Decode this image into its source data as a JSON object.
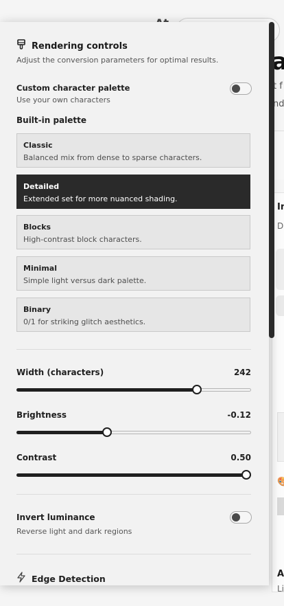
{
  "background": {
    "at_text": "At",
    "heading_fragment": "a",
    "line1_fragment": "t f",
    "line2_fragment": "nd",
    "card_title_fragment": "In",
    "card_sub_fragment": "Dr",
    "bottom_title_fragment": "A",
    "bottom_sub_fragment": "Li"
  },
  "panel": {
    "title": "Rendering controls",
    "title_icon": "brush-icon",
    "subtitle": "Adjust the conversion parameters for optimal results.",
    "custom_palette": {
      "title": "Custom character palette",
      "subtitle": "Use your own characters",
      "enabled": false
    },
    "builtin_label": "Built-in palette",
    "palettes": [
      {
        "name": "Classic",
        "desc": "Balanced mix from dense to sparse characters.",
        "selected": false
      },
      {
        "name": "Detailed",
        "desc": "Extended set for more nuanced shading.",
        "selected": true
      },
      {
        "name": "Blocks",
        "desc": "High-contrast block characters.",
        "selected": false
      },
      {
        "name": "Minimal",
        "desc": "Simple light versus dark palette.",
        "selected": false
      },
      {
        "name": "Binary",
        "desc": "0/1 for striking glitch aesthetics.",
        "selected": false
      }
    ],
    "sliders": [
      {
        "label": "Width (characters)",
        "value": "242",
        "fraction": 0.77
      },
      {
        "label": "Brightness",
        "value": "-0.12",
        "fraction": 0.385
      },
      {
        "label": "Contrast",
        "value": "0.50",
        "fraction": 0.98
      }
    ],
    "invert": {
      "title": "Invert luminance",
      "subtitle": "Reverse light and dark regions",
      "enabled": false
    },
    "edge": {
      "title": "Edge Detection",
      "icon": "lightning-icon"
    }
  },
  "colors": {
    "selected_bg": "#2a2a2a",
    "accent": "#1f1f1f"
  }
}
